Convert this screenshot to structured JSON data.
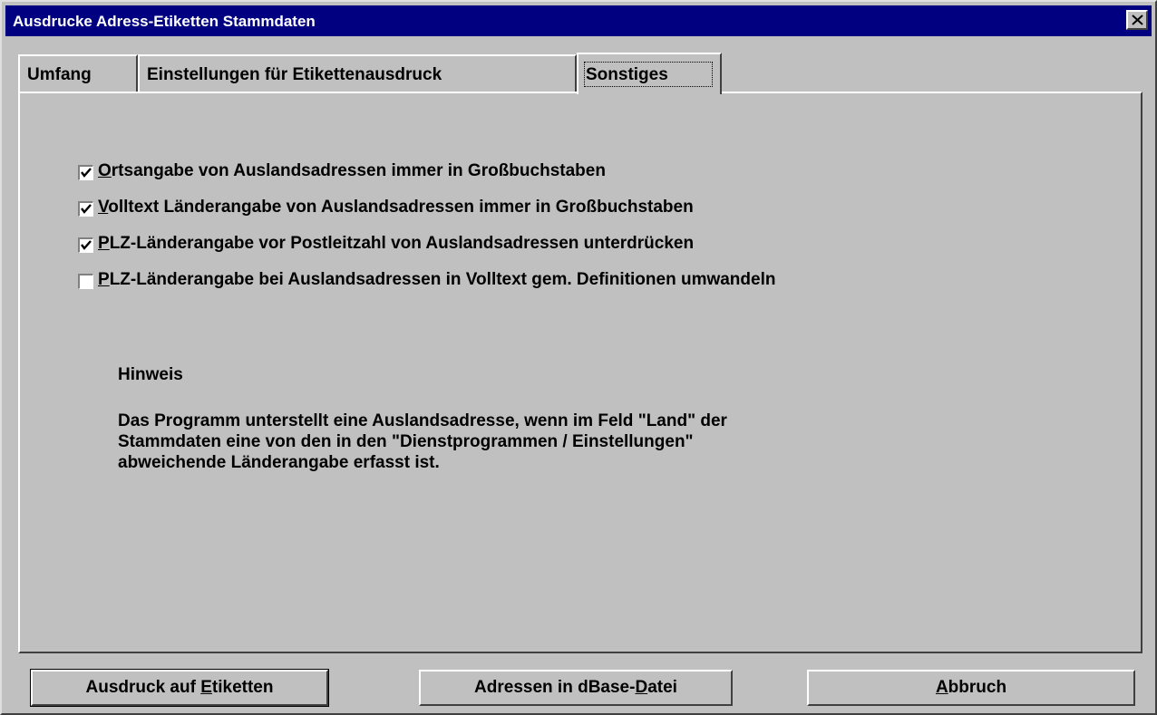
{
  "window": {
    "title": "Ausdrucke Adress-Etiketten Stammdaten"
  },
  "tabs": [
    {
      "label": "Umfang",
      "active": false
    },
    {
      "label": "Einstellungen für Etikettenausdruck",
      "active": false
    },
    {
      "label": "Sonstiges",
      "active": true
    }
  ],
  "options": [
    {
      "mnemonic": "O",
      "rest": "rtsangabe von Auslandsadressen immer in Großbuchstaben",
      "checked": true
    },
    {
      "mnemonic": "V",
      "rest": "olltext Länderangabe von Auslandsadressen immer in Großbuchstaben",
      "checked": true
    },
    {
      "mnemonic": "P",
      "rest": "LZ-Länderangabe vor Postleitzahl von Auslandsadressen unterdrücken",
      "checked": true
    },
    {
      "mnemonic": "P",
      "rest": "LZ-Länderangabe bei Auslandsadressen in Volltext gem. Definitionen umwandeln",
      "checked": false
    }
  ],
  "hint": {
    "title": "Hinweis",
    "lines": [
      "Das Programm unterstellt eine Auslandsadresse, wenn im Feld \"Land\" der",
      "Stammdaten eine von den in den \"Dienstprogrammen / Einstellungen\"",
      "abweichende Länderangabe erfasst ist."
    ]
  },
  "buttons": {
    "etiketten": {
      "pre": "Ausdruck auf ",
      "mnemonic": "E",
      "post": "tiketten"
    },
    "dbase": {
      "pre": "Adressen in dBase-",
      "mnemonic": "D",
      "post": "atei"
    },
    "abbruch": {
      "pre": "",
      "mnemonic": "A",
      "post": "bbruch"
    }
  }
}
